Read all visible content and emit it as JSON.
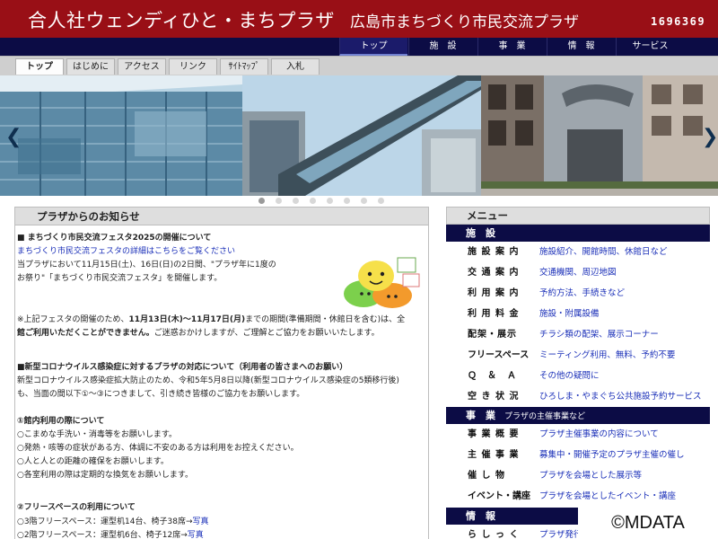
{
  "header": {
    "title": "合人社ウェンディひと・まちプラザ",
    "subtitle": "広島市まちづくり市民交流プラザ",
    "counter": "1696369",
    "bg_color": "#990f16"
  },
  "main_nav": [
    "トップ",
    "施　設",
    "事　業",
    "情　報",
    "サービス"
  ],
  "sub_nav": [
    "トップ",
    "はじめに",
    "アクセス",
    "リンク",
    "ｻｲﾄﾏｯﾌﾟ",
    "入札"
  ],
  "hero": {
    "prev_icon": "chevron-left-icon",
    "next_icon": "chevron-right-icon",
    "slide_count": 8,
    "active_slide": 1
  },
  "news": {
    "heading": "プラザからのお知らせ",
    "festival_title": "■ まちづくり市民交流フェスタ2025の開催について",
    "festival_link": "まちづくり市民交流フェスタの詳細はこちらをご覧ください",
    "festival_line1": "当プラザにおいて11月15日(土)、16日(日)の2日間、\"プラザ年に1度の",
    "festival_line2": "お祭り\"「まちづくり市民交流フェスタ」を開催します。",
    "notice_line1_a": "※上記フェスタの開催のため、",
    "notice_line1_b": "11月13日(木)～11月17日(月)",
    "notice_line1_c": "までの期間(準備期間・休館日を含む)は、全",
    "notice_line2_a": "館ご利用いただくことができません。",
    "notice_line2_b": "ご迷惑おかけしますが、ご理解とご協力をお願いいたします。",
    "covid_title": "■新型コロナウイルス感染症に対するプラザの対応について（利用者の皆さまへのお願い）",
    "covid_line1": "新型コロナウイルス感染症拡大防止のため、令和5年5月8日以降(新型コロナウイルス感染症の5類移行後)",
    "covid_line2": "も、当面の間以下①～③につきまして、引き続き皆様のご協力をお願いします。",
    "section1_title": "①館内利用の際について",
    "section1_items": [
      "○こまめな手洗い・消毒等をお願いします。",
      "○発熱・咳等の症状がある方、体調に不安のある方は利用をお控えください。",
      "○人と人との距離の確保をお願いします。",
      "○各室利用の際は定期的な換気をお願いします。"
    ],
    "section2_title": "②フリースペースの利用について",
    "section2_items": [
      {
        "text": "○3階フリースペース：運型机14台、椅子38席→",
        "link": "写真"
      },
      {
        "text": "○2階フリースペース：運型机6台、椅子12席→",
        "link": "写真"
      }
    ]
  },
  "menu": {
    "heading": "メニュー",
    "facilities_title": "施　設",
    "facilities": [
      {
        "label": "施 設 案 内",
        "value": "施設紹介、開館時間、休館日など"
      },
      {
        "label": "交 通 案 内",
        "value": "交通機関、周辺地図"
      },
      {
        "label": "利 用 案 内",
        "value": "予約方法、手続きなど"
      },
      {
        "label": "利 用 料 金",
        "value": "施設・附属設備"
      },
      {
        "label": "配架・展示",
        "value": "チラシ類の配架、展示コーナー"
      },
      {
        "label": "フリースペース",
        "value": "ミーティング利用、無料、予約不要"
      },
      {
        "label": "Ｑ　＆　Ａ",
        "value": "その他の疑問に"
      },
      {
        "label": "空 き 状 況",
        "value": "ひろしま・やまぐち公共施設予約サービス"
      }
    ],
    "events_title": "事　業",
    "events_subtitle": "プラザの主催事業など",
    "events": [
      {
        "label": "事 業 概 要",
        "value": "プラザ主催事業の内容について"
      },
      {
        "label": "主 催 事 業",
        "value": "募集中・開催予定のプラザ主催の催し"
      },
      {
        "label": "催 し 物",
        "value": "プラザを会場とした展示等"
      },
      {
        "label": "イベント・講座",
        "value": "プラザを会場としたイベント・講座"
      }
    ],
    "info_title": "情　報",
    "info": [
      {
        "label": "ら し っ く",
        "value": "プラザ発行の情報誌"
      }
    ]
  },
  "watermark": "©MDATA"
}
